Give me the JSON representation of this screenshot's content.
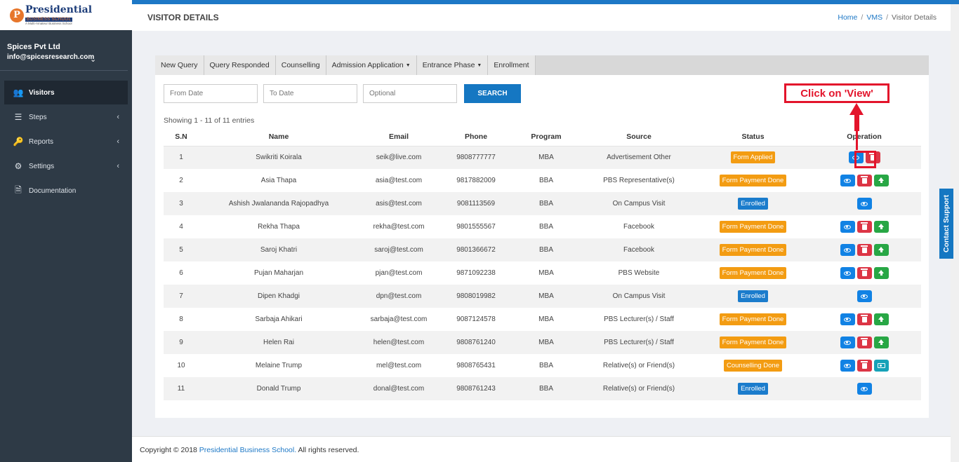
{
  "logo": {
    "title": "Presidential",
    "subtitle": "BUSINESS SCHOOL",
    "tagline": "A Multi-Amateur Business School",
    "mark": "P"
  },
  "user": {
    "name": "Spices Pvt Ltd",
    "email": "info@spicesresearch.com"
  },
  "menu": [
    {
      "label": "Visitors",
      "icon": "users-icon",
      "active": true
    },
    {
      "label": "Steps",
      "icon": "bars-icon"
    },
    {
      "label": "Reports",
      "icon": "key-icon"
    },
    {
      "label": "Settings",
      "icon": "gear-icon"
    },
    {
      "label": "Documentation",
      "icon": "file-pdf-icon"
    }
  ],
  "header": {
    "title": "VISITOR DETAILS",
    "breadcrumb": [
      "Home",
      "VMS",
      "Visitor Details"
    ]
  },
  "tabs": [
    {
      "label": "New Query"
    },
    {
      "label": "Query Responded"
    },
    {
      "label": "Counselling"
    },
    {
      "label": "Admission Application",
      "dropdown": true
    },
    {
      "label": "Entrance Phase",
      "dropdown": true
    },
    {
      "label": "Enrollment"
    }
  ],
  "filters": {
    "from_placeholder": "From Date",
    "to_placeholder": "To Date",
    "optional_placeholder": "Optional",
    "search_label": "SEARCH"
  },
  "showing": "Showing 1 - 11 of 11 entries",
  "table": {
    "headers": [
      "S.N",
      "Name",
      "Email",
      "Phone",
      "Program",
      "Source",
      "Status",
      "Operation"
    ],
    "rows": [
      {
        "sn": "1",
        "name": "Swikriti Koirala",
        "email": "seik@live.com",
        "phone": "9808777777",
        "program": "MBA",
        "source": "Advertisement Other",
        "status": "Form Applied",
        "status_color": "#f39c12",
        "ops": [
          "view",
          "delete"
        ]
      },
      {
        "sn": "2",
        "name": "Asia Thapa",
        "email": "asia@test.com",
        "phone": "9817882009",
        "program": "BBA",
        "source": "PBS Representative(s)",
        "status": "Form Payment Done",
        "status_color": "#f39c12",
        "ops": [
          "view",
          "delete",
          "upload"
        ]
      },
      {
        "sn": "3",
        "name": "Ashish Jwalananda Rajopadhya",
        "email": "asis@test.com",
        "phone": "9081113569",
        "program": "BBA",
        "source": "On Campus Visit",
        "status": "Enrolled",
        "status_color": "#1b7ccc",
        "ops": [
          "view"
        ]
      },
      {
        "sn": "4",
        "name": "Rekha Thapa",
        "email": "rekha@test.com",
        "phone": "9801555567",
        "program": "BBA",
        "source": "Facebook",
        "status": "Form Payment Done",
        "status_color": "#f39c12",
        "ops": [
          "view",
          "delete",
          "upload"
        ]
      },
      {
        "sn": "5",
        "name": "Saroj Khatri",
        "email": "saroj@test.com",
        "phone": "9801366672",
        "program": "BBA",
        "source": "Facebook",
        "status": "Form Payment Done",
        "status_color": "#f39c12",
        "ops": [
          "view",
          "delete",
          "upload"
        ]
      },
      {
        "sn": "6",
        "name": "Pujan Maharjan",
        "email": "pjan@test.com",
        "phone": "9871092238",
        "program": "MBA",
        "source": "PBS Website",
        "status": "Form Payment Done",
        "status_color": "#f39c12",
        "ops": [
          "view",
          "delete",
          "upload"
        ]
      },
      {
        "sn": "7",
        "name": "Dipen Khadgi",
        "email": "dpn@test.com",
        "phone": "9808019982",
        "program": "MBA",
        "source": "On Campus Visit",
        "status": "Enrolled",
        "status_color": "#1b7ccc",
        "ops": [
          "view"
        ]
      },
      {
        "sn": "8",
        "name": "Sarbaja Ahikari",
        "email": "sarbaja@test.com",
        "phone": "9087124578",
        "program": "MBA",
        "source": "PBS Lecturer(s) / Staff",
        "status": "Form Payment Done",
        "status_color": "#f39c12",
        "ops": [
          "view",
          "delete",
          "upload"
        ]
      },
      {
        "sn": "9",
        "name": "Helen Rai",
        "email": "helen@test.com",
        "phone": "9808761240",
        "program": "MBA",
        "source": "PBS Lecturer(s) / Staff",
        "status": "Form Payment Done",
        "status_color": "#f39c12",
        "ops": [
          "view",
          "delete",
          "upload"
        ]
      },
      {
        "sn": "10",
        "name": "Melaine Trump",
        "email": "mel@test.com",
        "phone": "9808765431",
        "program": "BBA",
        "source": "Relative(s) or Friend(s)",
        "status": "Counselling Done",
        "status_color": "#f39c12",
        "ops": [
          "view",
          "delete",
          "cash"
        ]
      },
      {
        "sn": "11",
        "name": "Donald Trump",
        "email": "donal@test.com",
        "phone": "9808761243",
        "program": "BBA",
        "source": "Relative(s) or Friend(s)",
        "status": "Enrolled",
        "status_color": "#1b7ccc",
        "ops": [
          "view"
        ]
      }
    ]
  },
  "annotation": {
    "text": "Click on 'View'",
    "color": "#e3142b"
  },
  "support_label": "Contact Support",
  "footer": {
    "prefix": "Copyright © 2018 ",
    "link": "Presidential Business School.",
    "suffix": " All rights reserved."
  },
  "colors": {
    "sidebar": "#2e3a46",
    "accent": "#1577c2",
    "orange": "#f39c12",
    "danger": "#dc3545",
    "success": "#28a745"
  }
}
